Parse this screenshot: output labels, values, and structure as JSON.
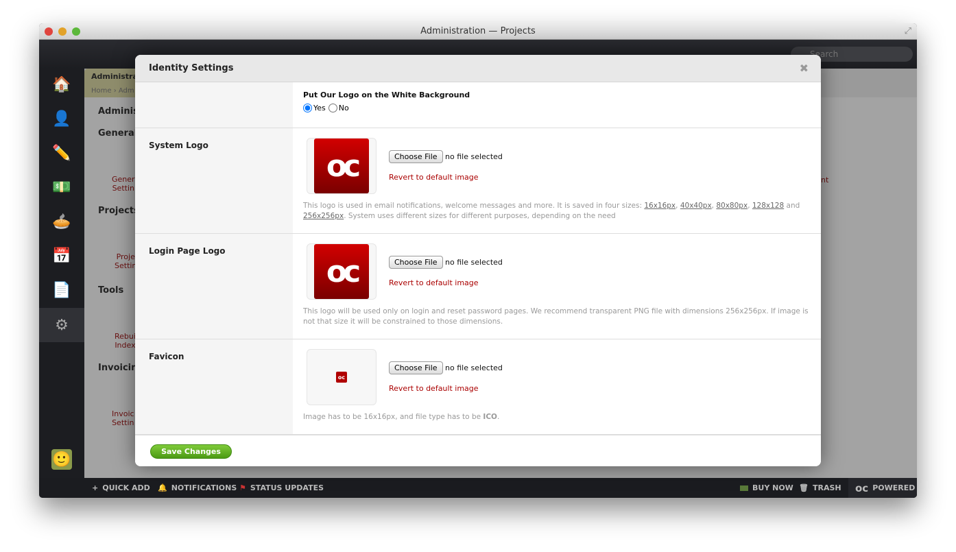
{
  "window": {
    "title": "Administration — Projects"
  },
  "topbar": {
    "search_placeholder": "Search"
  },
  "background": {
    "tab": "Administrati",
    "breadcrumb_home": "Home",
    "breadcrumb_2": "Adm",
    "heading": "Adminis",
    "sections": [
      "General",
      "Projects",
      "Tools",
      "Invoicing"
    ],
    "items": [
      "Gener\nSettin",
      "Proje\nSettin",
      "Rebui\nIndex",
      "Invoic\nSettin"
    ],
    "right_fragment": "nt"
  },
  "modal": {
    "title": "Identity Settings",
    "white_bg": {
      "label": "Put Our Logo on the White Background",
      "yes": "Yes",
      "no": "No",
      "selected": "Yes"
    },
    "rows": [
      {
        "label": "System Logo",
        "choose": "Choose File",
        "status": "no file selected",
        "revert": "Revert to default image",
        "help_pre": "This logo is used in email notifications, welcome messages and more. It is saved in four sizes: ",
        "sizes": [
          "16x16px",
          "40x40px",
          "80x80px",
          "128x128",
          "256x256px"
        ],
        "help_post": ". System uses different sizes for different purposes, depending on the need"
      },
      {
        "label": "Login Page Logo",
        "choose": "Choose File",
        "status": "no file selected",
        "revert": "Revert to default image",
        "help": "This logo will be used only on login and reset password pages. We recommend transparent PNG file with dimensions 256x256px. If image is not that size it will be constrained to those dimensions."
      },
      {
        "label": "Favicon",
        "choose": "Choose File",
        "status": "no file selected",
        "revert": "Revert to default image",
        "help_pre": "Image has to be 16x16px, and file type has to be ",
        "help_bold": "ICO",
        "help_post": "."
      }
    ],
    "save": "Save Changes",
    "logo_text": "oc"
  },
  "bottombar": {
    "quick_add": "QUICK ADD",
    "notifications": "NOTIFICATIONS",
    "status_updates": "STATUS UPDATES",
    "buy_now": "BUY NOW",
    "trash": "TRASH",
    "powered": "POWERED"
  },
  "colors": {
    "accent": "#aa0000",
    "save": "#5fae22"
  }
}
